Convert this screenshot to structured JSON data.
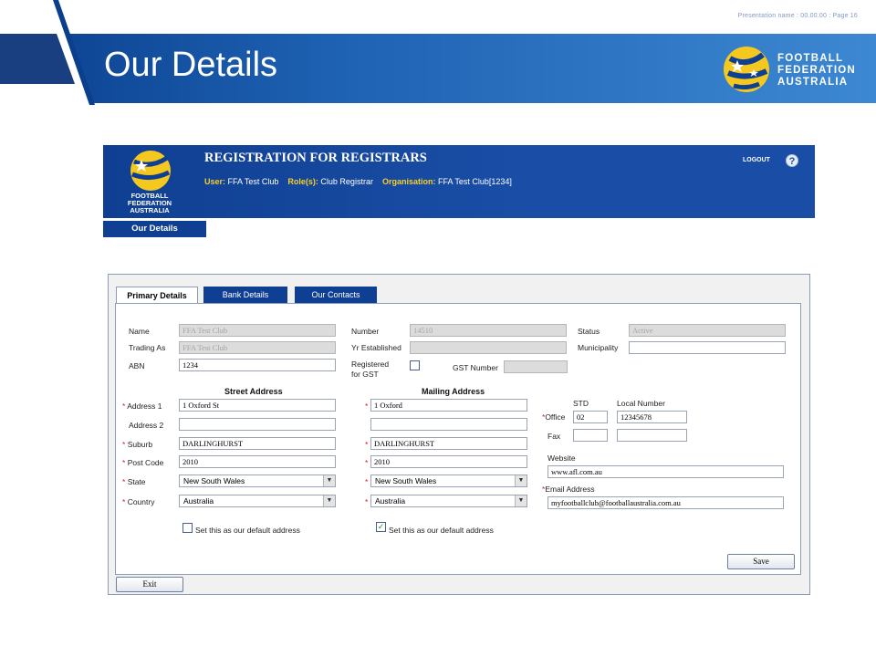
{
  "slide": {
    "meta": "Presentation name : 00.00.00 : Page 16",
    "title": "Our Details",
    "logo_lines": [
      "FOOTBALL",
      "FEDERATION",
      "AUSTRALIA"
    ]
  },
  "app": {
    "title": "REGISTRATION FOR REGISTRARS",
    "user_label": "User:",
    "user_value": "FFA Test Club",
    "roles_label": "Role(s):",
    "roles_value": "Club Registrar",
    "org_label": "Organisation:",
    "org_value": "FFA Test Club[1234]",
    "logout": "LOGOUT",
    "help": "?",
    "logo_lines": [
      "FOOTBALL",
      "FEDERATION",
      "AUSTRALIA"
    ],
    "nav_tab": "Our Details"
  },
  "tabs": [
    "Primary Details",
    "Bank Details",
    "Our Contacts"
  ],
  "form": {
    "name_label": "Name",
    "name_value": "FFA Test Club",
    "trading_label": "Trading As",
    "trading_value": "FFA Test Club",
    "abn_label": "ABN",
    "abn_value": "1234",
    "number_label": "Number",
    "number_value": "14510",
    "yr_label": "Yr Established",
    "yr_value": "",
    "gst_reg_label_1": "Registered",
    "gst_reg_label_2": "for GST",
    "gst_number_label": "GST Number",
    "gst_number_value": "",
    "status_label": "Status",
    "status_value": "Active",
    "municipality_label": "Municipality",
    "municipality_value": "",
    "street_header": "Street Address",
    "mailing_header": "Mailing Address",
    "address1_label": "Address 1",
    "address2_label": "Address 2",
    "suburb_label": "Suburb",
    "postcode_label": "Post Code",
    "state_label": "State",
    "country_label": "Country",
    "street": {
      "address1": "1 Oxford St",
      "address2": "",
      "suburb": "DARLINGHURST",
      "postcode": "2010",
      "state": "New South Wales",
      "country": "Australia",
      "default_label": "Set this as our default address",
      "default_checked": false
    },
    "mailing": {
      "address1": "1 Oxford",
      "address2": "",
      "suburb": "DARLINGHURST",
      "postcode": "2010",
      "state": "New South Wales",
      "country": "Australia",
      "default_label": "Set this as our default address",
      "default_checked": true
    },
    "std_label": "STD",
    "local_label": "Local Number",
    "office_label": "Office",
    "office_std": "02",
    "office_local": "12345678",
    "fax_label": "Fax",
    "fax_std": "",
    "fax_local": "",
    "website_label": "Website",
    "website_value": "www.afl.com.au",
    "email_label": "Email Address",
    "email_value": "myfootballclub@footballaustralia.com.au",
    "required_mark": "*",
    "check_mark": "✓"
  },
  "buttons": {
    "save": "Save",
    "exit": "Exit"
  }
}
